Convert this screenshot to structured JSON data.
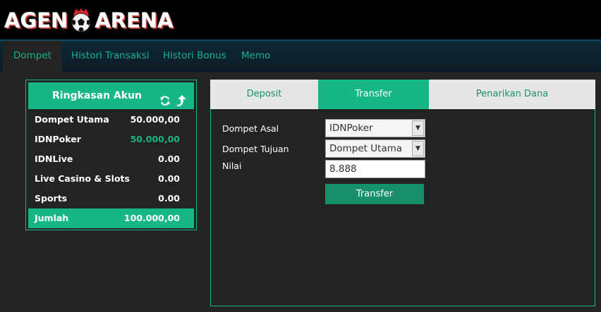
{
  "logo": {
    "left": "AGEN",
    "right": "ARENA"
  },
  "nav": {
    "tabs": [
      {
        "label": "Dompet",
        "active": true
      },
      {
        "label": "Histori Transaksi",
        "active": false
      },
      {
        "label": "Histori Bonus",
        "active": false
      },
      {
        "label": "Memo",
        "active": false
      }
    ]
  },
  "summary": {
    "title": "Ringkasan Akun",
    "icons": [
      "refresh-icon",
      "upload-arrow-icon"
    ],
    "rows": [
      {
        "label": "Dompet Utama",
        "value": "50.000,00"
      },
      {
        "label": "IDNPoker",
        "value": "50.000,00",
        "highlight": true
      },
      {
        "label": "IDNLive",
        "value": "0.00"
      },
      {
        "label": "Live Casino & Slots",
        "value": "0.00"
      },
      {
        "label": "Sports",
        "value": "0.00"
      }
    ],
    "total": {
      "label": "Jumlah",
      "value": "100.000,00"
    }
  },
  "transfer": {
    "tabs": [
      {
        "label": "Deposit",
        "active": false
      },
      {
        "label": "Transfer",
        "active": true
      },
      {
        "label": "Penarikan Dana",
        "active": false
      }
    ],
    "from_label": "Dompet Asal",
    "from_value": "IDNPoker",
    "to_label": "Dompet Tujuan",
    "to_value": "Dompet Utama",
    "amount_label": "Nilai",
    "amount_value": "8.888",
    "submit_label": "Transfer"
  },
  "colors": {
    "accent": "#16b686",
    "button": "#16906c",
    "background": "#232323",
    "header": "#000000"
  }
}
